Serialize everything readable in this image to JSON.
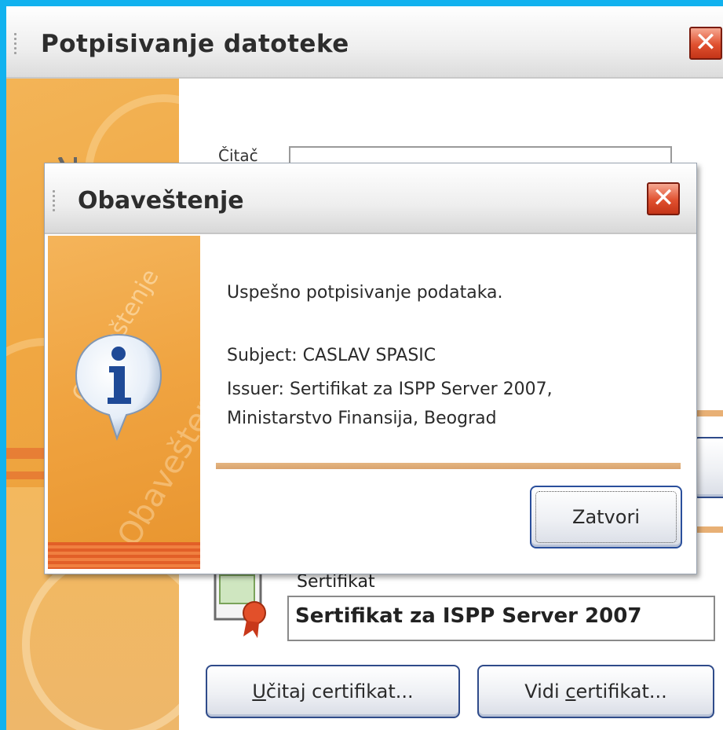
{
  "outer_window": {
    "title": "Potpisivanje datoteke",
    "card_reader_label": "Čitač",
    "certificate_label": "Sertifikat",
    "certificate_value": "Sertifikat za ISPP Server 2007",
    "load_button_access_key": "U",
    "load_button_rest": "čitaj certifikat...",
    "view_button_prefix": "Vidi ",
    "view_button_access_key": "c",
    "view_button_rest": "ertifikat..."
  },
  "dialog": {
    "title": "Obaveštenje",
    "sidebar_watermark": "Obaveštenje",
    "message": "Uspešno potpisivanje podataka.",
    "subject": "Subject: CASLAV SPASIC",
    "issuer_line1": "Issuer: Sertifikat za ISPP Server 2007,",
    "issuer_line2": "Ministarstvo Finansija, Beograd",
    "close_button_label": "Zatvori"
  },
  "icons": {
    "window_close": "close-icon",
    "info": "info-icon",
    "usb_reader": "usb-reader-icon",
    "certificate": "certificate-icon"
  },
  "colors": {
    "background": "#11b2ef",
    "sidebar_orange": "#f0a742",
    "close_red": "#e0502f",
    "button_border": "#2f4b8a"
  }
}
